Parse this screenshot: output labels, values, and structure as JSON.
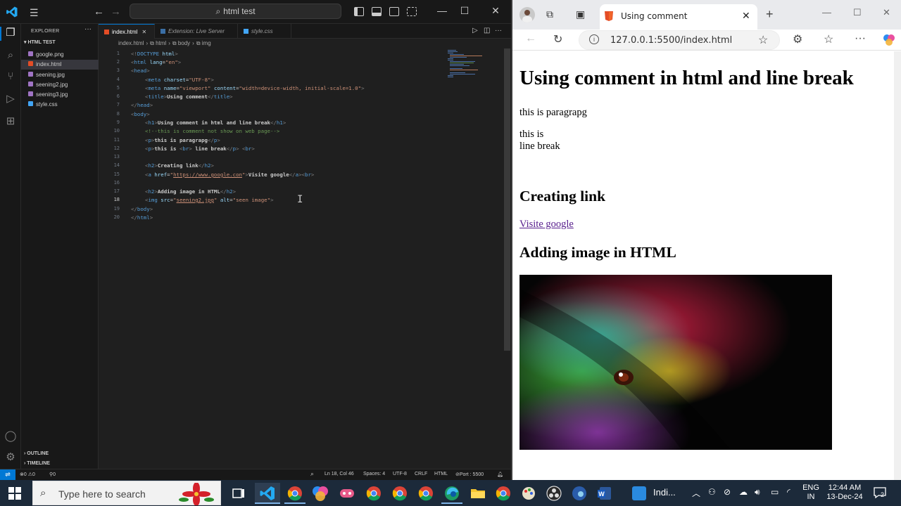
{
  "vscode": {
    "command_center": "html test",
    "explorer": {
      "title": "EXPLORER",
      "folder": "HTML TEST",
      "files": [
        "google.png",
        "index.html",
        "seening.jpg",
        "seening2.jpg",
        "seening3.jpg",
        "style.css"
      ],
      "selected": "index.html",
      "outline": "OUTLINE",
      "timeline": "TIMELINE"
    },
    "tabs": [
      {
        "label": "index.html",
        "active": true
      },
      {
        "label": "Extension: Live Server",
        "active": false
      },
      {
        "label": "style.css",
        "active": false
      }
    ],
    "breadcrumb": [
      "index.html",
      "html",
      "body",
      "img"
    ],
    "line_numbers": [
      "1",
      "2",
      "3",
      "4",
      "5",
      "6",
      "7",
      "8",
      "9",
      "10",
      "11",
      "12",
      "13",
      "14",
      "15",
      "16",
      "17",
      "18",
      "19",
      "20"
    ],
    "current_line": "18",
    "code": {
      "l1_a": "<!",
      "l1_b": "DOCTYPE",
      "l1_c": " html",
      "l1_d": ">",
      "l2_name": "html",
      "l2_attr": "lang",
      "l2_val": "\"en\"",
      "l3": "head",
      "l4_name": "meta",
      "l4_attr": "charset",
      "l4_val": "\"UTF-8\"",
      "l5_name": "meta",
      "l5_attr1": "name",
      "l5_val1": "\"viewport\"",
      "l5_attr2": "content",
      "l5_val2": "\"width=device-width, initial-scale=1.0\"",
      "l6_name": "title",
      "l6_text": "Using comment",
      "l7": "head",
      "l8": "body",
      "l9_name": "h1",
      "l9_text": "Using comment in html and line break",
      "l10": "<!--this is comment not show on web page-->",
      "l11_name": "p",
      "l11_text": "this is paragrapg",
      "l12_name": "p",
      "l12_text1": "this is ",
      "l12_br": "br",
      "l12_text2": " line break",
      "l12_br2": "br",
      "l14_name": "h2",
      "l14_text": "Creating link",
      "l15_name": "a",
      "l15_attr": "href",
      "l15_val": "https://www.google.con",
      "l15_text": "Visite google",
      "l15_br": "br",
      "l17_name": "h2",
      "l17_text": "Adding image in HTML",
      "l18_name": "img",
      "l18_attr1": "src",
      "l18_val1": "seening2.jpg",
      "l18_attr2": "alt",
      "l18_val2": "\"seen image\"",
      "l19": "body",
      "l20": "html"
    },
    "status": {
      "errors": "0",
      "warnings": "0",
      "ports": "0",
      "position": "Ln 18, Col 46",
      "spaces": "Spaces: 4",
      "encoding": "UTF-8",
      "eol": "CRLF",
      "language": "HTML",
      "port": "Port : 5500"
    }
  },
  "browser": {
    "tab_title": "Using comment",
    "url": "127.0.0.1:5500/index.html",
    "page": {
      "h1": "Using comment in html and line break",
      "p1": "this is paragrapg",
      "p2_line1": "this is",
      "p2_line2": "line break",
      "h2_link": "Creating link",
      "link_text": "Visite google",
      "h2_image": "Adding image in HTML"
    }
  },
  "taskbar": {
    "search_placeholder": "Type here to search",
    "weather": "Indi...",
    "lang_top": "ENG",
    "lang_bottom": "IN",
    "time": "12:44 AM",
    "date": "13-Dec-24",
    "notif_count": "2"
  },
  "colors": {
    "accent": "#0078d4",
    "link": "#551a8b",
    "taskbar": "#1c2a3a"
  }
}
